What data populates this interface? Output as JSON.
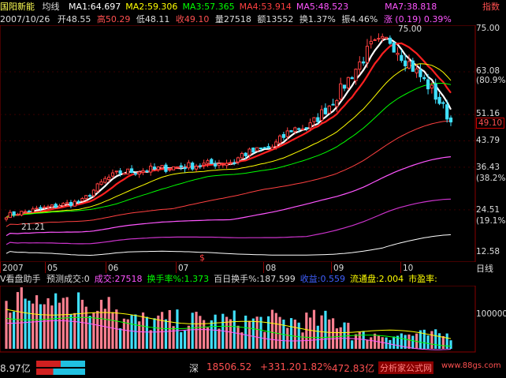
{
  "header": {
    "stock_name": "国阳新能",
    "indicator": "均线",
    "ma_values": [
      {
        "label": "MA1:64.697",
        "color": "#ffffff"
      },
      {
        "label": "MA2:59.306",
        "color": "#ffff00"
      },
      {
        "label": "MA3:57.365",
        "color": "#00ff00"
      },
      {
        "label": "MA4:53.914",
        "color": "#ff4040"
      },
      {
        "label": "MA5:48.523",
        "color": "#ff55ff"
      },
      {
        "label": "MA7:38.818",
        "color": "#ff55ff"
      }
    ],
    "indicator_tail": "指数"
  },
  "info_line": {
    "date": "2007/10/26",
    "open": "开48.55",
    "high": "高50.29",
    "low": "低48.11",
    "close": "收49.10",
    "volume": "量27518",
    "amount": "额13552",
    "turnover": "换1.37%",
    "amplitude": "振4.46%",
    "change": "涨 (0.19) 0.39%"
  },
  "price_axis": {
    "labels": [
      "75.00",
      "63.08",
      "(80.9%)",
      "51.16",
      "49.10",
      "43.79",
      "36.43",
      "(38.2%)",
      "24.51",
      "(19.1%)",
      "12.58"
    ],
    "peak_label": "75.00",
    "low_label": "21.21"
  },
  "time_axis": {
    "labels": [
      "2007",
      "05",
      "06",
      "07",
      "08",
      "09",
      "10"
    ],
    "mode_label": "日线",
    "marker": "$"
  },
  "volume_panel": {
    "title": "V看盘助手",
    "items": [
      {
        "text": "预测成交:0",
        "color": "#dddddd"
      },
      {
        "text": "成交:27518",
        "color": "#ff55ff"
      },
      {
        "text": "换手率%:1.373",
        "color": "#00ff00"
      },
      {
        "text": "百日换手%:187.599",
        "color": "#dddddd"
      },
      {
        "text": "收益:0.559",
        "color": "#4060ff"
      },
      {
        "text": "流通盘:2.004",
        "color": "#ffff00"
      },
      {
        "text": "市盈率:",
        "color": "#ffff00"
      }
    ],
    "axis_label": "100000"
  },
  "footer": {
    "left_value": "8.97亿",
    "market": "深",
    "index_value": "18506.52",
    "change": "+331.20",
    "change_pct": "1.82%",
    "amount": "472.83亿",
    "site_left": "分析家公式网",
    "site_right": "www.88gs.com"
  },
  "chart_data": {
    "type": "candlestick",
    "title": "国阳新能 均线",
    "price_range": [
      12.58,
      75.0
    ],
    "last_close": 49.1,
    "peak": 75.0,
    "low": 21.21,
    "months": [
      "2007",
      "05",
      "06",
      "07",
      "08",
      "09",
      "10"
    ],
    "series": [
      {
        "name": "MA1",
        "color": "#ffffff"
      },
      {
        "name": "MA2",
        "color": "#ffff00"
      },
      {
        "name": "MA3",
        "color": "#00ff00"
      },
      {
        "name": "MA4",
        "color": "#ff4040"
      },
      {
        "name": "MA5",
        "color": "#ff55ff"
      },
      {
        "name": "MA7",
        "color": "#ff55ff"
      }
    ]
  }
}
